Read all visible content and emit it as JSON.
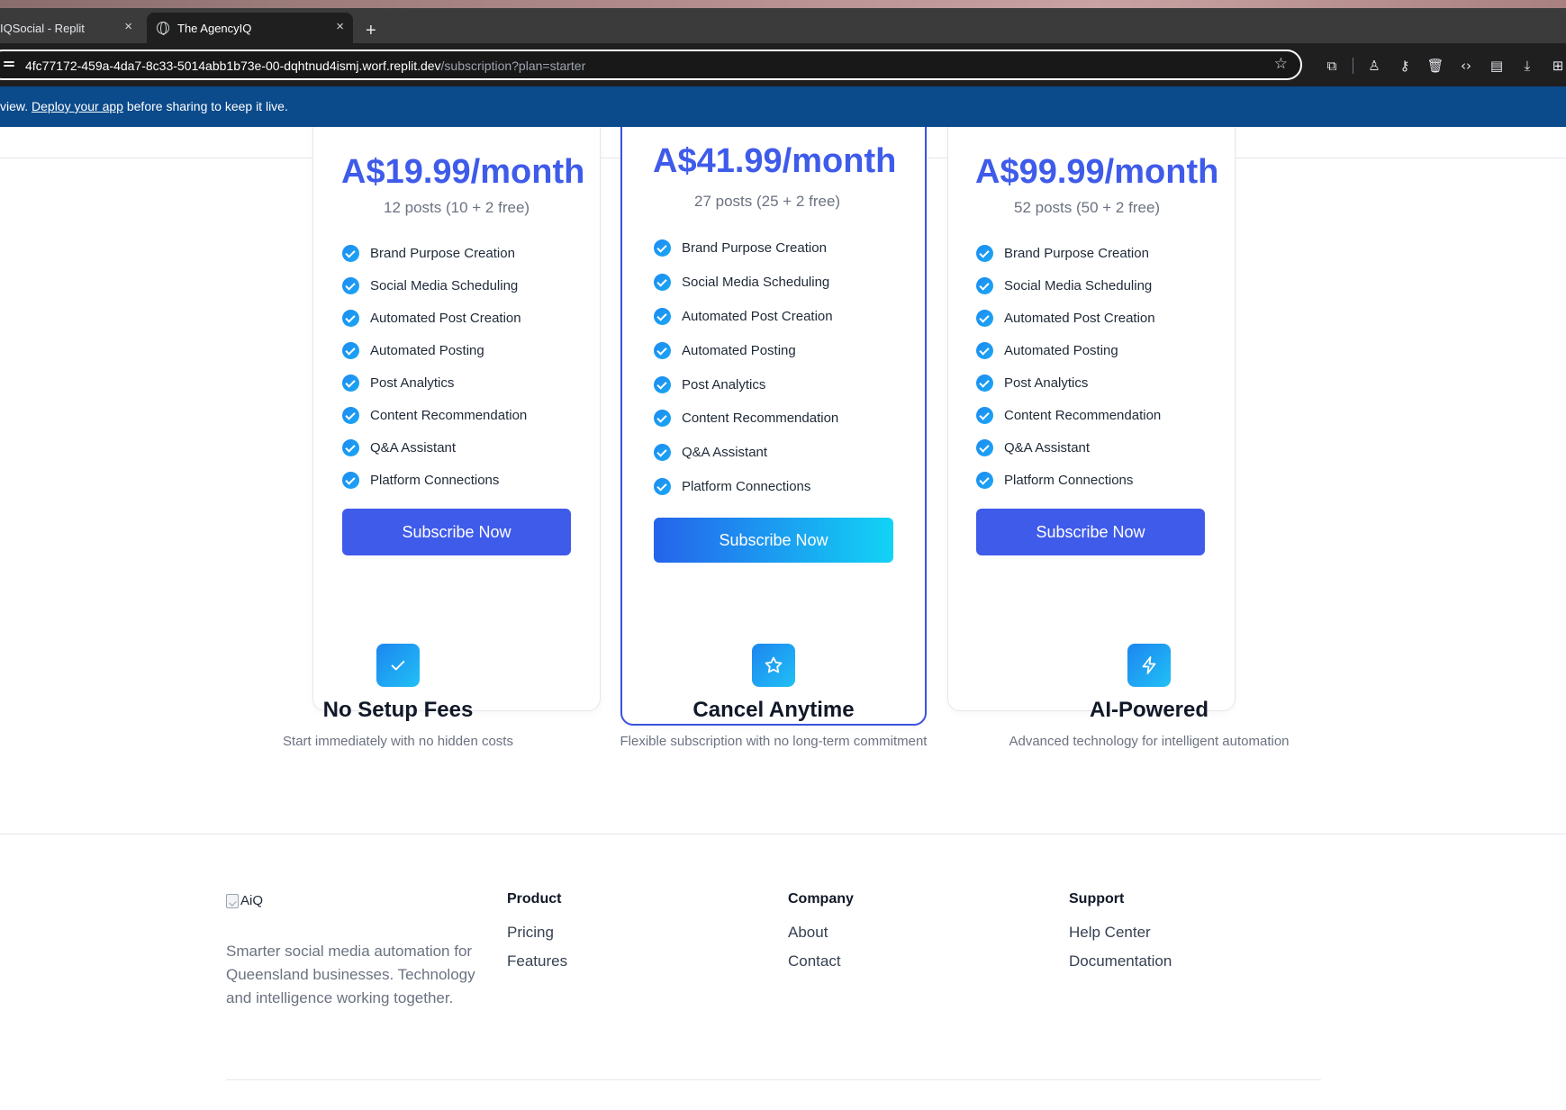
{
  "browser": {
    "tabs": [
      {
        "label": "IQSocial - Replit",
        "active": false
      },
      {
        "label": "The AgencyIQ",
        "active": true
      }
    ],
    "new_tab": "+",
    "close": "×",
    "url_host": "4fc77172-459a-4da7-8c33-5014abb1b73e-00-dqhtnud4ismj.worf.replit.dev",
    "url_path": "/subscription?plan=starter",
    "banner": {
      "before": "view. ",
      "link": "Deploy your app",
      "after": " before sharing to keep it live."
    }
  },
  "plans": [
    {
      "price": "A$19.99/month",
      "posts": "12 posts (10 + 2 free)",
      "features": [
        "Brand Purpose Creation",
        "Social Media Scheduling",
        "Automated Post Creation",
        "Automated Posting",
        "Post Analytics",
        "Content Recommendation",
        "Q&A Assistant",
        "Platform Connections"
      ],
      "button": "Subscribe Now",
      "featured": false
    },
    {
      "price": "A$41.99/month",
      "posts": "27 posts (25 + 2 free)",
      "features": [
        "Brand Purpose Creation",
        "Social Media Scheduling",
        "Automated Post Creation",
        "Automated Posting",
        "Post Analytics",
        "Content Recommendation",
        "Q&A Assistant",
        "Platform Connections"
      ],
      "button": "Subscribe Now",
      "featured": true
    },
    {
      "price": "A$99.99/month",
      "posts": "52 posts (50 + 2 free)",
      "features": [
        "Brand Purpose Creation",
        "Social Media Scheduling",
        "Automated Post Creation",
        "Automated Posting",
        "Post Analytics",
        "Content Recommendation",
        "Q&A Assistant",
        "Platform Connections"
      ],
      "button": "Subscribe Now",
      "featured": false
    }
  ],
  "benefits": [
    {
      "icon": "check-icon",
      "title": "No Setup Fees",
      "text": "Start immediately with no hidden costs"
    },
    {
      "icon": "star-icon",
      "title": "Cancel Anytime",
      "text": "Flexible subscription with no long-term commitment"
    },
    {
      "icon": "lightning-icon",
      "title": "AI-Powered",
      "text": "Advanced technology for intelligent automation"
    }
  ],
  "footer": {
    "logo_alt": "AiQ",
    "tagline": "Smarter social media automation for Queensland businesses. Technology and intelligence working together.",
    "columns": [
      {
        "heading": "Product",
        "links": [
          "Pricing",
          "Features"
        ]
      },
      {
        "heading": "Company",
        "links": [
          "About",
          "Contact"
        ]
      },
      {
        "heading": "Support",
        "links": [
          "Help Center",
          "Documentation"
        ]
      }
    ]
  },
  "colors": {
    "accent": "#3f5bea",
    "banner": "#0b4a8b",
    "check": "#1d8bf0"
  }
}
